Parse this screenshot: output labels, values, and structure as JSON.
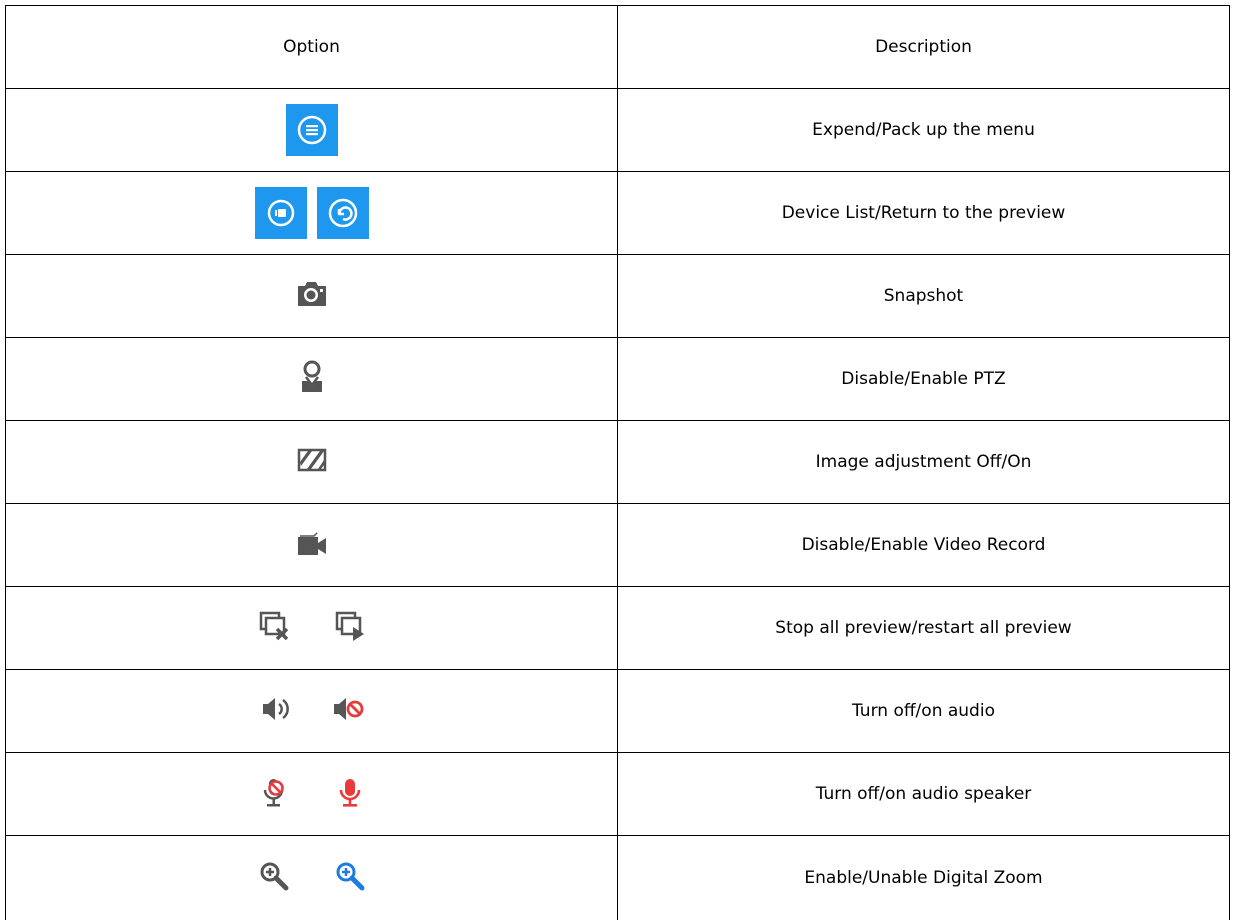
{
  "table": {
    "headers": {
      "option": "Option",
      "description": "Description"
    },
    "rows": [
      {
        "icons": [
          "menu-icon"
        ],
        "description": "Expend/Pack up the menu"
      },
      {
        "icons": [
          "device-list-icon",
          "return-icon"
        ],
        "description": "Device List/Return to the preview"
      },
      {
        "icons": [
          "camera-icon"
        ],
        "description": "Snapshot"
      },
      {
        "icons": [
          "ptz-icon"
        ],
        "description": "Disable/Enable PTZ"
      },
      {
        "icons": [
          "image-adjust-icon"
        ],
        "description": "Image adjustment Off/On"
      },
      {
        "icons": [
          "video-record-icon"
        ],
        "description": "Disable/Enable Video Record"
      },
      {
        "icons": [
          "stop-all-preview-icon",
          "restart-all-preview-icon"
        ],
        "description": "Stop all preview/restart all preview"
      },
      {
        "icons": [
          "audio-on-icon",
          "audio-off-icon"
        ],
        "description": "Turn off/on audio"
      },
      {
        "icons": [
          "speaker-off-icon",
          "speaker-on-icon"
        ],
        "description": "Turn off/on audio speaker"
      },
      {
        "icons": [
          "zoom-gray-icon",
          "zoom-blue-icon"
        ],
        "description": "Enable/Unable Digital Zoom"
      }
    ]
  },
  "colors": {
    "blue_button": "#1e98ee",
    "icon_gray": "#555555",
    "icon_red": "#e83a3a",
    "icon_blue": "#1e7be0"
  }
}
